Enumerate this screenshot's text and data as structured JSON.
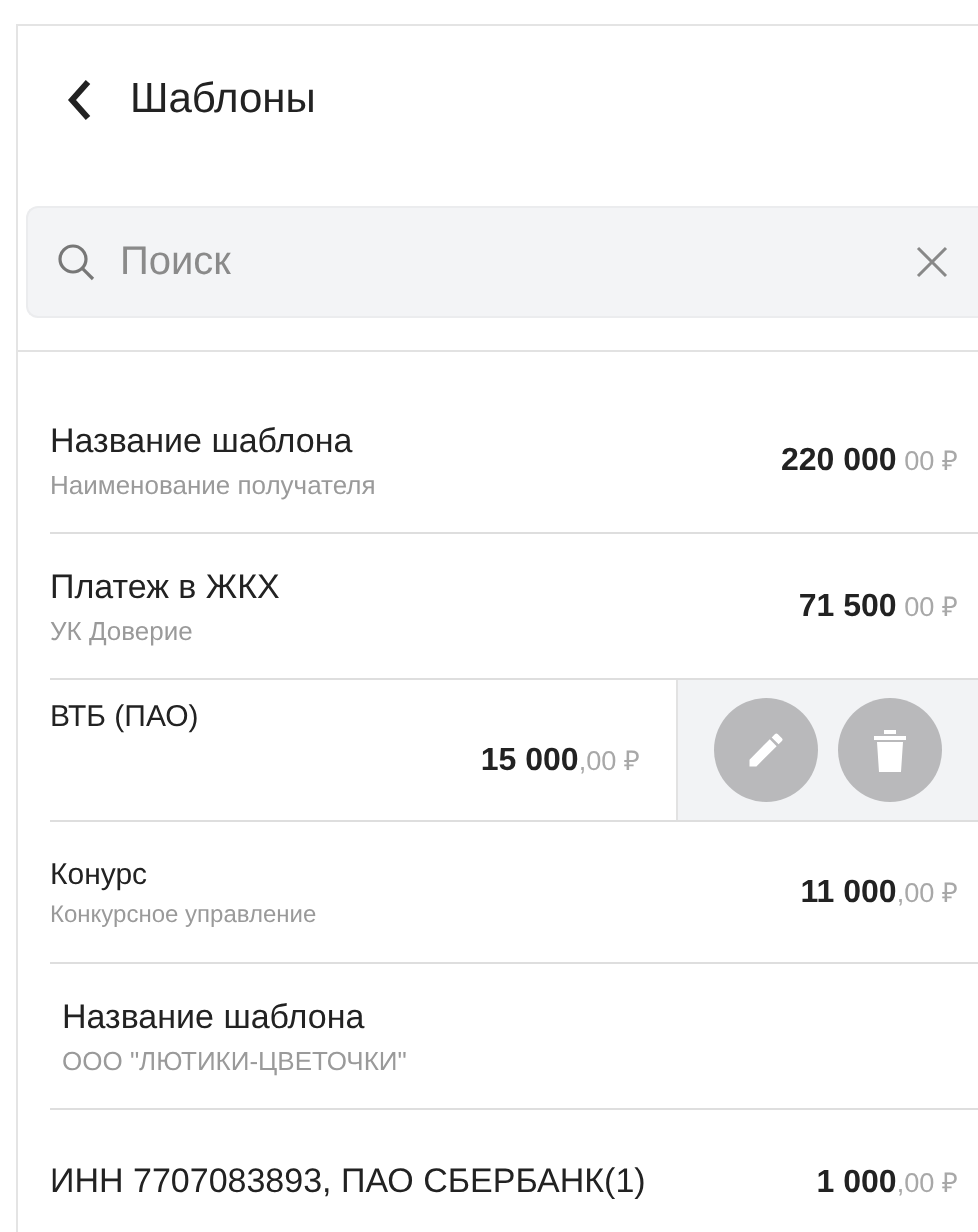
{
  "header": {
    "title": "Шаблоны"
  },
  "search": {
    "placeholder": "Поиск"
  },
  "templates": [
    {
      "kind": "large",
      "swiped": false,
      "name": "Название шаблона",
      "recipient": "Наименование получателя",
      "amount": "220 000",
      "cents": " 00 ₽"
    },
    {
      "kind": "large",
      "swiped": false,
      "name": "Платеж в ЖКХ",
      "recipient": "УК Доверие",
      "amount": "71 500",
      "cents": " 00 ₽"
    },
    {
      "kind": "small",
      "swiped": true,
      "name": "ВТБ (ПАО)",
      "amount": "15 000",
      "cents": ",00 ₽"
    },
    {
      "kind": "small",
      "swiped": false,
      "name": "Конурс",
      "recipient": "Конкурсное управление",
      "amount": "11 000",
      "cents": ",00 ₽"
    },
    {
      "kind": "large",
      "swiped": false,
      "name": "Название шаблона",
      "recipient": "ООО \"ЛЮТИКИ-ЦВЕТОЧКИ\""
    },
    {
      "kind": "medium",
      "swiped": false,
      "name": "ИНН 7707083893, ПАО СБЕРБАНК(1)",
      "amount": "1 000",
      "cents": ",00 ₽"
    }
  ]
}
